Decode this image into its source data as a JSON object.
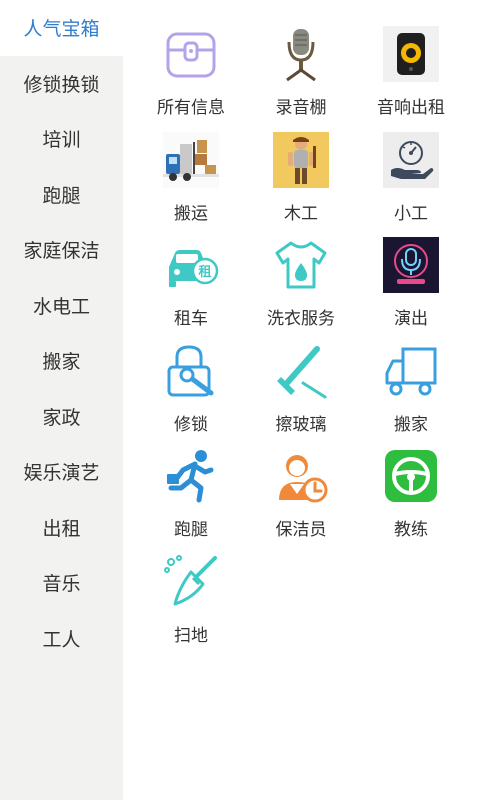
{
  "sidebar": {
    "items": [
      {
        "label": "人气宝箱",
        "active": true
      },
      {
        "label": "修锁换锁"
      },
      {
        "label": "培训"
      },
      {
        "label": "跑腿"
      },
      {
        "label": "家庭保洁"
      },
      {
        "label": "水电工"
      },
      {
        "label": "搬家"
      },
      {
        "label": "家政"
      },
      {
        "label": "娱乐演艺"
      },
      {
        "label": "出租"
      },
      {
        "label": "音乐"
      },
      {
        "label": "工人"
      }
    ]
  },
  "grid": {
    "items": [
      {
        "label": "所有信息",
        "icon": "treasure-box-icon"
      },
      {
        "label": "录音棚",
        "icon": "microphone-icon"
      },
      {
        "label": "音响出租",
        "icon": "speaker-icon"
      },
      {
        "label": "搬运",
        "icon": "delivery-truck-icon"
      },
      {
        "label": "木工",
        "icon": "carpenter-icon"
      },
      {
        "label": "小工",
        "icon": "hand-gauge-icon"
      },
      {
        "label": "租车",
        "icon": "rental-car-icon"
      },
      {
        "label": "洗衣服务",
        "icon": "tshirt-icon"
      },
      {
        "label": "演出",
        "icon": "neon-microphone-icon"
      },
      {
        "label": "修锁",
        "icon": "lock-wrench-icon"
      },
      {
        "label": "擦玻璃",
        "icon": "squeegee-icon"
      },
      {
        "label": "搬家",
        "icon": "truck-outline-icon"
      },
      {
        "label": "跑腿",
        "icon": "running-man-icon"
      },
      {
        "label": "保洁员",
        "icon": "cleaner-clock-icon"
      },
      {
        "label": "教练",
        "icon": "steering-wheel-icon"
      },
      {
        "label": "扫地",
        "icon": "broom-icon"
      }
    ]
  },
  "colors": {
    "sidebar_bg": "#f2f2f0",
    "active_text": "#2f7fd0",
    "icon_teal": "#3ec9c5",
    "icon_blue": "#3a9fe0"
  }
}
